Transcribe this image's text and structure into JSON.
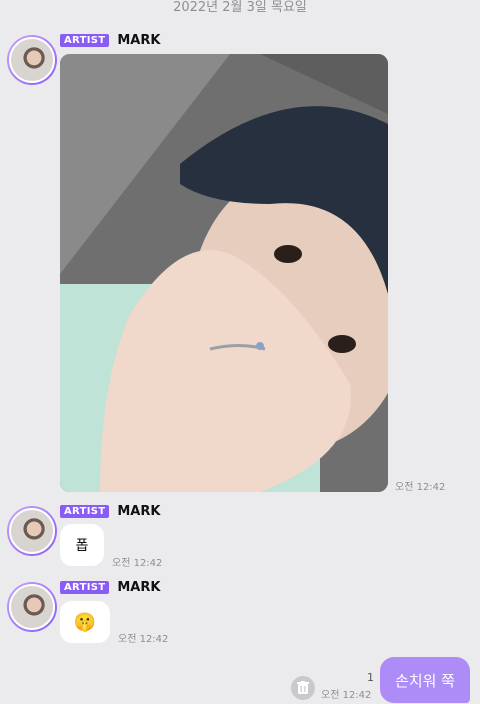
{
  "date_header": "2022년 2월 3일 목요일",
  "messages": [
    {
      "badge": "ARTIST",
      "sender": "MARK",
      "time": "오전 12:42"
    },
    {
      "badge": "ARTIST",
      "sender": "MARK",
      "text": "폽",
      "time": "오전 12:42"
    },
    {
      "badge": "ARTIST",
      "sender": "MARK",
      "emoji": "🤫",
      "time": "오전 12:42"
    }
  ],
  "my_message": {
    "text": "손치워 쭉",
    "read_count": "1",
    "time": "오전 12:42"
  },
  "colors": {
    "accent": "#8a5cf6",
    "my_bubble": "#ad8cf7",
    "background": "#ebebee"
  }
}
